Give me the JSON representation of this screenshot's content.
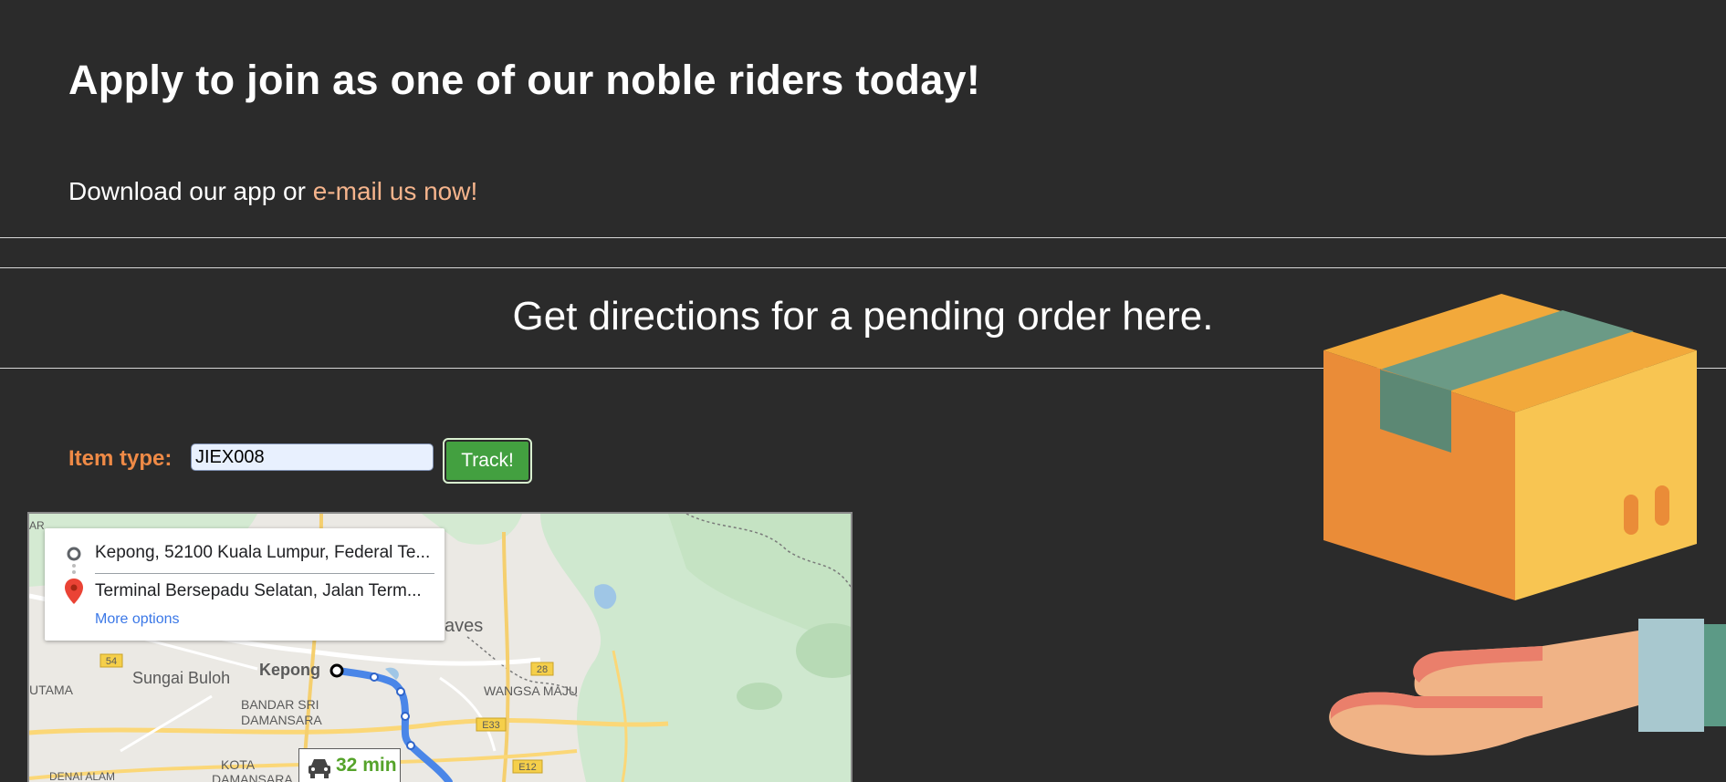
{
  "recruit": {
    "headline": "Apply to join as one of our noble riders today!",
    "download_prefix": "Download our app or ",
    "email_link": "e-mail us now!"
  },
  "directions": {
    "heading": "Get directions for a pending order here."
  },
  "tracking": {
    "item_label": "Item type:",
    "item_value": "JIEX008",
    "track_button": "Track!"
  },
  "map": {
    "origin": "Kepong, 52100 Kuala Lumpur, Federal Te...",
    "destination": "Terminal Bersepadu Selatan, Jalan Term...",
    "more_options": "More options",
    "duration": "32 min",
    "labels": {
      "kepong": "Kepong",
      "sungai_buloh": "Sungai Buloh",
      "bandar_sri": "BANDAR SRI",
      "damansara": "DAMANSARA",
      "wangsa_maju": "WANGSA MAJU",
      "kota": "KOTA",
      "damansara2": "DAMANSARA",
      "denai_alam": "DENAI ALAM",
      "utama": "UTAMA",
      "ar": "AR",
      "aves": "aves",
      "r54": "54",
      "r28": "28",
      "e33": "E33",
      "e12": "E12"
    },
    "icons": {
      "origin": "origin-circle-icon",
      "destination": "location-pin-icon",
      "car": "car-icon"
    },
    "route_color": "#4a86e8"
  },
  "illustration": {
    "name": "package-on-hand-icon"
  },
  "colors": {
    "background": "#2b2b2b",
    "accent": "#ef8a46",
    "link": "#f5b48c",
    "button": "#43a040"
  }
}
